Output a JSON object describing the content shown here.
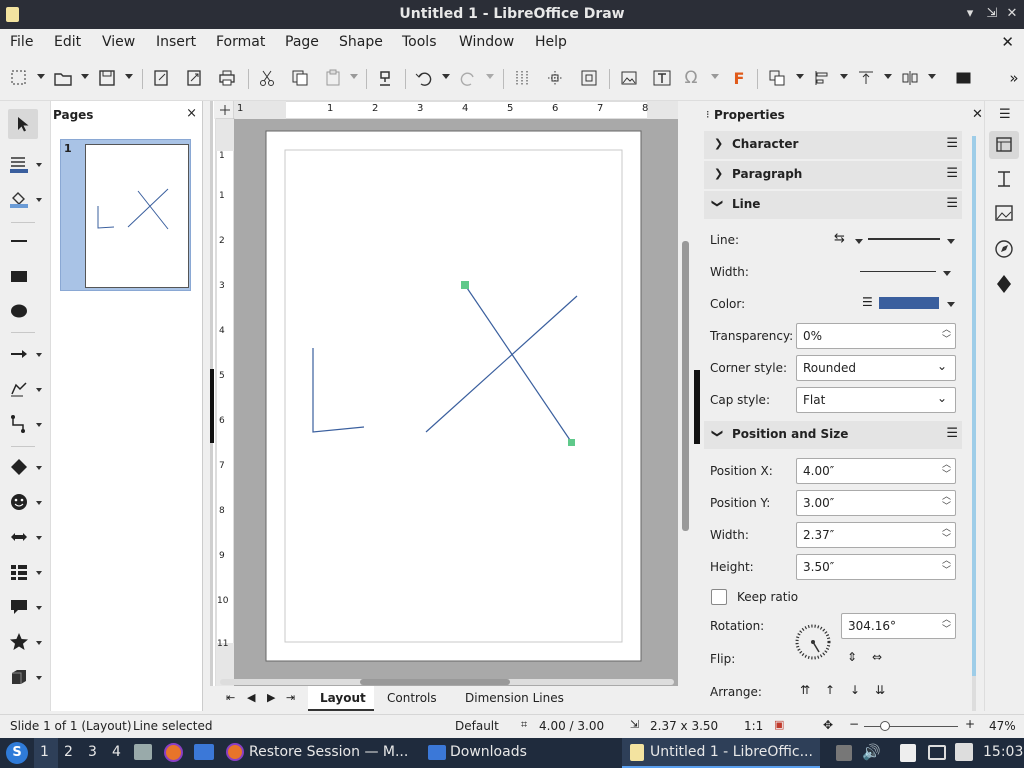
{
  "window": {
    "title": "Untitled 1 - LibreOffice Draw"
  },
  "menu": [
    "File",
    "Edit",
    "View",
    "Insert",
    "Format",
    "Page",
    "Shape",
    "Tools",
    "Window",
    "Help"
  ],
  "pages_panel": {
    "title": "Pages",
    "close": "×",
    "thumbnail_number": "1"
  },
  "ruler": {
    "h_labels": [
      "1",
      "1",
      "2",
      "3",
      "4",
      "5",
      "6",
      "7",
      "8"
    ],
    "v_labels": [
      "1",
      "1",
      "2",
      "3",
      "4",
      "5",
      "6",
      "7",
      "8",
      "9",
      "10",
      "11"
    ]
  },
  "bottom_tabs": {
    "layout": "Layout",
    "controls": "Controls",
    "dimension_lines": "Dimension Lines"
  },
  "properties": {
    "title": "Properties",
    "sections": {
      "character": "Character",
      "paragraph": "Paragraph",
      "line": "Line",
      "position_size": "Position and Size"
    },
    "line": {
      "line_label": "Line:",
      "width_label": "Width:",
      "color_label": "Color:",
      "color_value": "#3a5f9e",
      "transparency_label": "Transparency:",
      "transparency_value": "0%",
      "corner_label": "Corner style:",
      "corner_value": "Rounded",
      "cap_label": "Cap style:",
      "cap_value": "Flat"
    },
    "pos": {
      "x_label": "Position X:",
      "x_value": "4.00″",
      "y_label": "Position Y:",
      "y_value": "3.00″",
      "w_label": "Width:",
      "w_value": "2.37″",
      "h_label": "Height:",
      "h_value": "3.50″",
      "keep_ratio": "Keep ratio",
      "rotation_label": "Rotation:",
      "rotation_value": "304.16°",
      "flip_label": "Flip:",
      "arrange_label": "Arrange:"
    }
  },
  "status": {
    "slide": "Slide 1 of 1 (Layout)",
    "selection": "Line selected",
    "style": "Default",
    "position": "4.00 / 3.00",
    "size": "2.37 x 3.50",
    "scale": "1:1",
    "zoom_minus": "−",
    "zoom_plus": "+",
    "zoom": "47%"
  },
  "taskbar": {
    "workspaces": [
      "1",
      "2",
      "3",
      "4"
    ],
    "firefox_task": "Restore Session — M...",
    "downloads_task": "Downloads",
    "draw_task": "Untitled 1 - LibreOffic...",
    "clock": "15:03"
  },
  "colors": {
    "titlebar": "#2b2e37",
    "taskbar": "#1f2b3d",
    "line_color": "#3a5f9e",
    "handle": "#5fc98a",
    "selected_page": "#a9c3e6"
  }
}
